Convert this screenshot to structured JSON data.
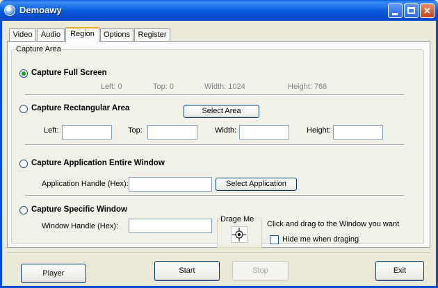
{
  "window": {
    "title": "Demoawy"
  },
  "tabs": [
    {
      "label": "Video"
    },
    {
      "label": "Audio"
    },
    {
      "label": "Region",
      "active": true
    },
    {
      "label": "Options"
    },
    {
      "label": "Register"
    }
  ],
  "capture_area": {
    "group_label": "Capture Area",
    "full_screen": {
      "label": "Capture Full Screen",
      "selected": true,
      "left_text": "Left: 0",
      "top_text": "Top: 0",
      "width_text": "Width: 1024",
      "height_text": "Height: 768"
    },
    "rectangular": {
      "label": "Capture Rectangular Area",
      "select_area_button": "Select Area",
      "left_label": "Left:",
      "top_label": "Top:",
      "width_label": "Width:",
      "height_label": "Height:",
      "left_value": "",
      "top_value": "",
      "width_value": "",
      "height_value": ""
    },
    "app_window": {
      "label": "Capture Application Entire Window",
      "handle_label": "Application Handle (Hex):",
      "handle_value": "",
      "select_button": "Select Application"
    },
    "specific_window": {
      "label": "Capture Specific Window",
      "handle_label": "Window Handle (Hex):",
      "handle_value": "",
      "drag_label": "Drage Me",
      "instruction": "Click and drag to the Window you want",
      "hide_checkbox_label": "Hide me when draging",
      "hide_checked": false
    }
  },
  "footer": {
    "player_button": "Player",
    "start_button": "Start",
    "stop_button": "Stop",
    "stop_enabled": false,
    "exit_button": "Exit"
  },
  "colors": {
    "titlebar": "#0a5de0",
    "window_bg": "#ece9d8",
    "radio_selected": "#21a121",
    "active_tab_accent": "#f5a623"
  }
}
